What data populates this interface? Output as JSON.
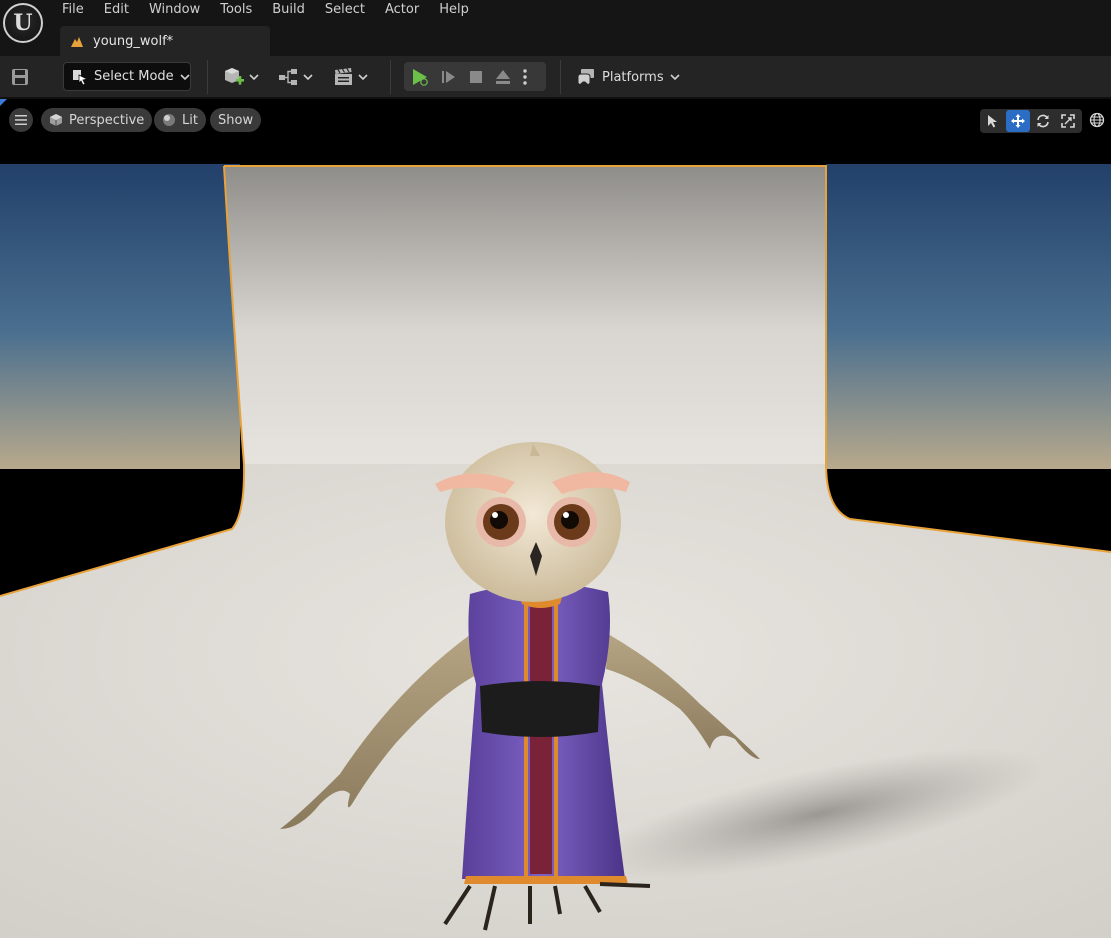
{
  "app": {
    "logo_letter": "U",
    "logo_icon": "unreal-engine-logo"
  },
  "menu": [
    "File",
    "Edit",
    "Window",
    "Tools",
    "Build",
    "Select",
    "Actor",
    "Help"
  ],
  "document_tab": {
    "label": "young_wolf*",
    "icon": "level-icon",
    "icon_color": "#e8a23a"
  },
  "toolbar": {
    "save_icon": "save-icon",
    "select_mode_label": "Select Mode",
    "create_icon": "add-content-icon",
    "blueprint_icon": "blueprint-icon",
    "cinematics_icon": "cinematics-icon",
    "play_icon": "play-icon",
    "play_color": "#6cc04a",
    "platforms_label": "Platforms"
  },
  "viewport": {
    "menu_icon": "hamburger-icon",
    "perspective_label": "Perspective",
    "lit_label": "Lit",
    "show_label": "Show",
    "transform_tools": [
      "select-icon",
      "translate-icon",
      "rotate-icon",
      "scale-icon"
    ],
    "active_tool": "translate-icon",
    "accent_color": "#2b6cc4",
    "selection_outline_color": "#e8a23a",
    "scene_description_icon": "owl-character"
  }
}
